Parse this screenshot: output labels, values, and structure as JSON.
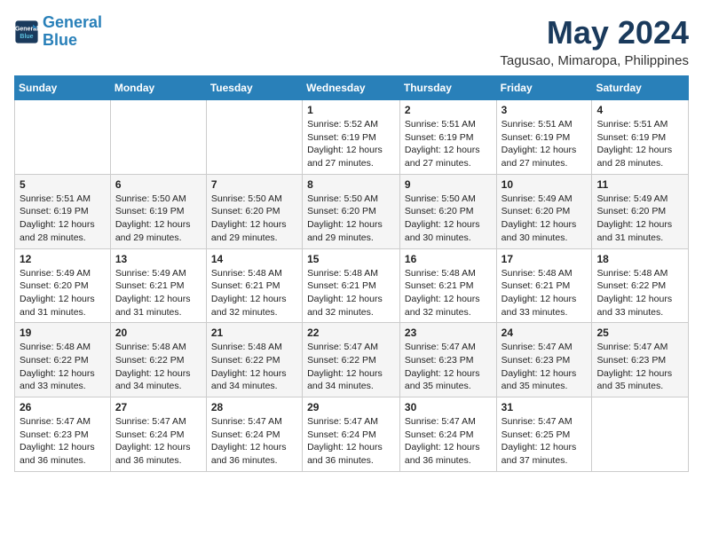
{
  "logo": {
    "line1": "General",
    "line2": "Blue"
  },
  "title": "May 2024",
  "subtitle": "Tagusao, Mimaropa, Philippines",
  "weekdays": [
    "Sunday",
    "Monday",
    "Tuesday",
    "Wednesday",
    "Thursday",
    "Friday",
    "Saturday"
  ],
  "weeks": [
    [
      {
        "day": "",
        "info": ""
      },
      {
        "day": "",
        "info": ""
      },
      {
        "day": "",
        "info": ""
      },
      {
        "day": "1",
        "info": "Sunrise: 5:52 AM\nSunset: 6:19 PM\nDaylight: 12 hours\nand 27 minutes."
      },
      {
        "day": "2",
        "info": "Sunrise: 5:51 AM\nSunset: 6:19 PM\nDaylight: 12 hours\nand 27 minutes."
      },
      {
        "day": "3",
        "info": "Sunrise: 5:51 AM\nSunset: 6:19 PM\nDaylight: 12 hours\nand 27 minutes."
      },
      {
        "day": "4",
        "info": "Sunrise: 5:51 AM\nSunset: 6:19 PM\nDaylight: 12 hours\nand 28 minutes."
      }
    ],
    [
      {
        "day": "5",
        "info": "Sunrise: 5:51 AM\nSunset: 6:19 PM\nDaylight: 12 hours\nand 28 minutes."
      },
      {
        "day": "6",
        "info": "Sunrise: 5:50 AM\nSunset: 6:19 PM\nDaylight: 12 hours\nand 29 minutes."
      },
      {
        "day": "7",
        "info": "Sunrise: 5:50 AM\nSunset: 6:20 PM\nDaylight: 12 hours\nand 29 minutes."
      },
      {
        "day": "8",
        "info": "Sunrise: 5:50 AM\nSunset: 6:20 PM\nDaylight: 12 hours\nand 29 minutes."
      },
      {
        "day": "9",
        "info": "Sunrise: 5:50 AM\nSunset: 6:20 PM\nDaylight: 12 hours\nand 30 minutes."
      },
      {
        "day": "10",
        "info": "Sunrise: 5:49 AM\nSunset: 6:20 PM\nDaylight: 12 hours\nand 30 minutes."
      },
      {
        "day": "11",
        "info": "Sunrise: 5:49 AM\nSunset: 6:20 PM\nDaylight: 12 hours\nand 31 minutes."
      }
    ],
    [
      {
        "day": "12",
        "info": "Sunrise: 5:49 AM\nSunset: 6:20 PM\nDaylight: 12 hours\nand 31 minutes."
      },
      {
        "day": "13",
        "info": "Sunrise: 5:49 AM\nSunset: 6:21 PM\nDaylight: 12 hours\nand 31 minutes."
      },
      {
        "day": "14",
        "info": "Sunrise: 5:48 AM\nSunset: 6:21 PM\nDaylight: 12 hours\nand 32 minutes."
      },
      {
        "day": "15",
        "info": "Sunrise: 5:48 AM\nSunset: 6:21 PM\nDaylight: 12 hours\nand 32 minutes."
      },
      {
        "day": "16",
        "info": "Sunrise: 5:48 AM\nSunset: 6:21 PM\nDaylight: 12 hours\nand 32 minutes."
      },
      {
        "day": "17",
        "info": "Sunrise: 5:48 AM\nSunset: 6:21 PM\nDaylight: 12 hours\nand 33 minutes."
      },
      {
        "day": "18",
        "info": "Sunrise: 5:48 AM\nSunset: 6:22 PM\nDaylight: 12 hours\nand 33 minutes."
      }
    ],
    [
      {
        "day": "19",
        "info": "Sunrise: 5:48 AM\nSunset: 6:22 PM\nDaylight: 12 hours\nand 33 minutes."
      },
      {
        "day": "20",
        "info": "Sunrise: 5:48 AM\nSunset: 6:22 PM\nDaylight: 12 hours\nand 34 minutes."
      },
      {
        "day": "21",
        "info": "Sunrise: 5:48 AM\nSunset: 6:22 PM\nDaylight: 12 hours\nand 34 minutes."
      },
      {
        "day": "22",
        "info": "Sunrise: 5:47 AM\nSunset: 6:22 PM\nDaylight: 12 hours\nand 34 minutes."
      },
      {
        "day": "23",
        "info": "Sunrise: 5:47 AM\nSunset: 6:23 PM\nDaylight: 12 hours\nand 35 minutes."
      },
      {
        "day": "24",
        "info": "Sunrise: 5:47 AM\nSunset: 6:23 PM\nDaylight: 12 hours\nand 35 minutes."
      },
      {
        "day": "25",
        "info": "Sunrise: 5:47 AM\nSunset: 6:23 PM\nDaylight: 12 hours\nand 35 minutes."
      }
    ],
    [
      {
        "day": "26",
        "info": "Sunrise: 5:47 AM\nSunset: 6:23 PM\nDaylight: 12 hours\nand 36 minutes."
      },
      {
        "day": "27",
        "info": "Sunrise: 5:47 AM\nSunset: 6:24 PM\nDaylight: 12 hours\nand 36 minutes."
      },
      {
        "day": "28",
        "info": "Sunrise: 5:47 AM\nSunset: 6:24 PM\nDaylight: 12 hours\nand 36 minutes."
      },
      {
        "day": "29",
        "info": "Sunrise: 5:47 AM\nSunset: 6:24 PM\nDaylight: 12 hours\nand 36 minutes."
      },
      {
        "day": "30",
        "info": "Sunrise: 5:47 AM\nSunset: 6:24 PM\nDaylight: 12 hours\nand 36 minutes."
      },
      {
        "day": "31",
        "info": "Sunrise: 5:47 AM\nSunset: 6:25 PM\nDaylight: 12 hours\nand 37 minutes."
      },
      {
        "day": "",
        "info": ""
      }
    ]
  ]
}
